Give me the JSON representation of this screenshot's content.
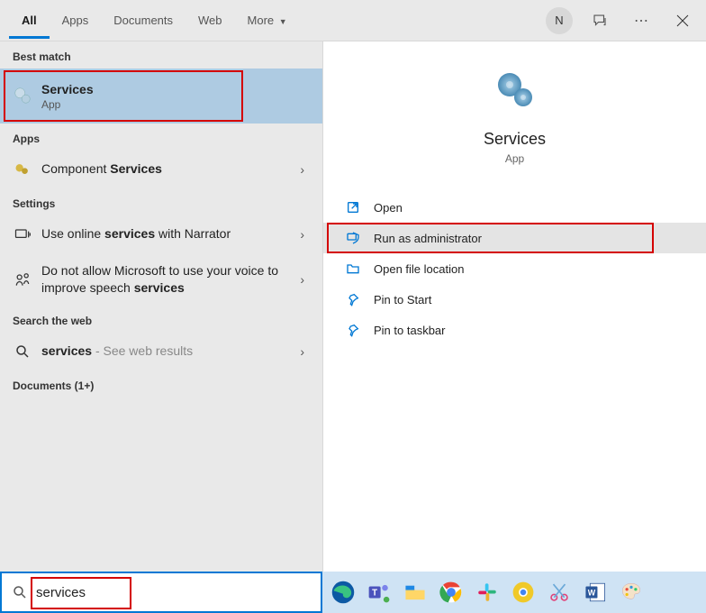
{
  "topbar": {
    "tabs": [
      "All",
      "Apps",
      "Documents",
      "Web",
      "More"
    ],
    "active_index": 0,
    "user_initial": "N"
  },
  "left": {
    "best_match_label": "Best match",
    "best_match": {
      "title": "Services",
      "subtitle": "App"
    },
    "apps_label": "Apps",
    "apps_item_prefix": "Component ",
    "apps_item_bold": "Services",
    "settings_label": "Settings",
    "setting1_pre": "Use online ",
    "setting1_bold": "services",
    "setting1_post": " with Narrator",
    "setting2_pre": "Do not allow Microsoft to use your voice to improve speech ",
    "setting2_bold": "services",
    "web_label": "Search the web",
    "web_item_bold": "services",
    "web_item_suffix": " - See web results",
    "documents_label": "Documents (1+)"
  },
  "right": {
    "hero_title": "Services",
    "hero_sub": "App",
    "actions": [
      "Open",
      "Run as administrator",
      "Open file location",
      "Pin to Start",
      "Pin to taskbar"
    ],
    "highlight_index": 1
  },
  "search": {
    "value": "services"
  }
}
